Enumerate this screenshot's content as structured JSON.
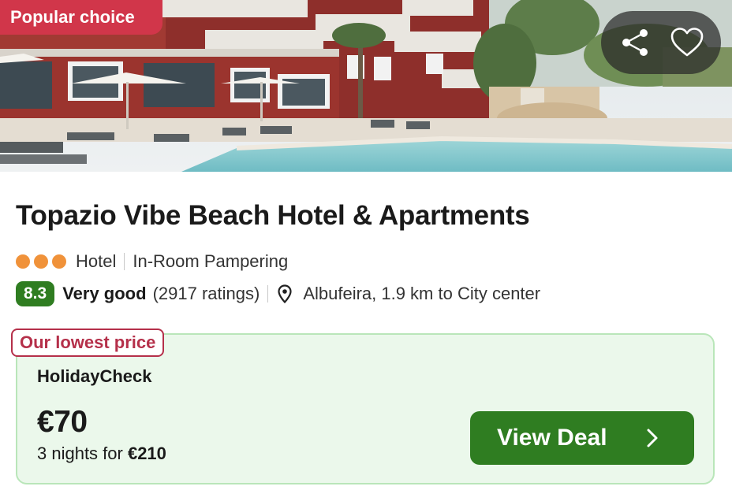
{
  "hero": {
    "badge": "Popular choice",
    "actions": [
      {
        "icon": "share-icon"
      },
      {
        "icon": "heart-icon"
      }
    ]
  },
  "hotel": {
    "name": "Topazio Vibe Beach Hotel & Apartments",
    "stars": 3,
    "type": "Hotel",
    "feature": "In-Room Pampering",
    "score": "8.3",
    "verdict": "Very good",
    "ratings": "(2917 ratings)",
    "location": "Albufeira, 1.9 km to City center"
  },
  "deal": {
    "tag": "Our lowest price",
    "provider": "HolidayCheck",
    "price": "€70",
    "nights_prefix": "3 nights for ",
    "total": "€210",
    "button_label": "View Deal"
  },
  "colors": {
    "badge": "#d1364a",
    "accent_green": "#2f7d21",
    "star_orange": "#f0923a",
    "tag_red": "#b5304a",
    "card_bg": "#ebf8eb"
  }
}
